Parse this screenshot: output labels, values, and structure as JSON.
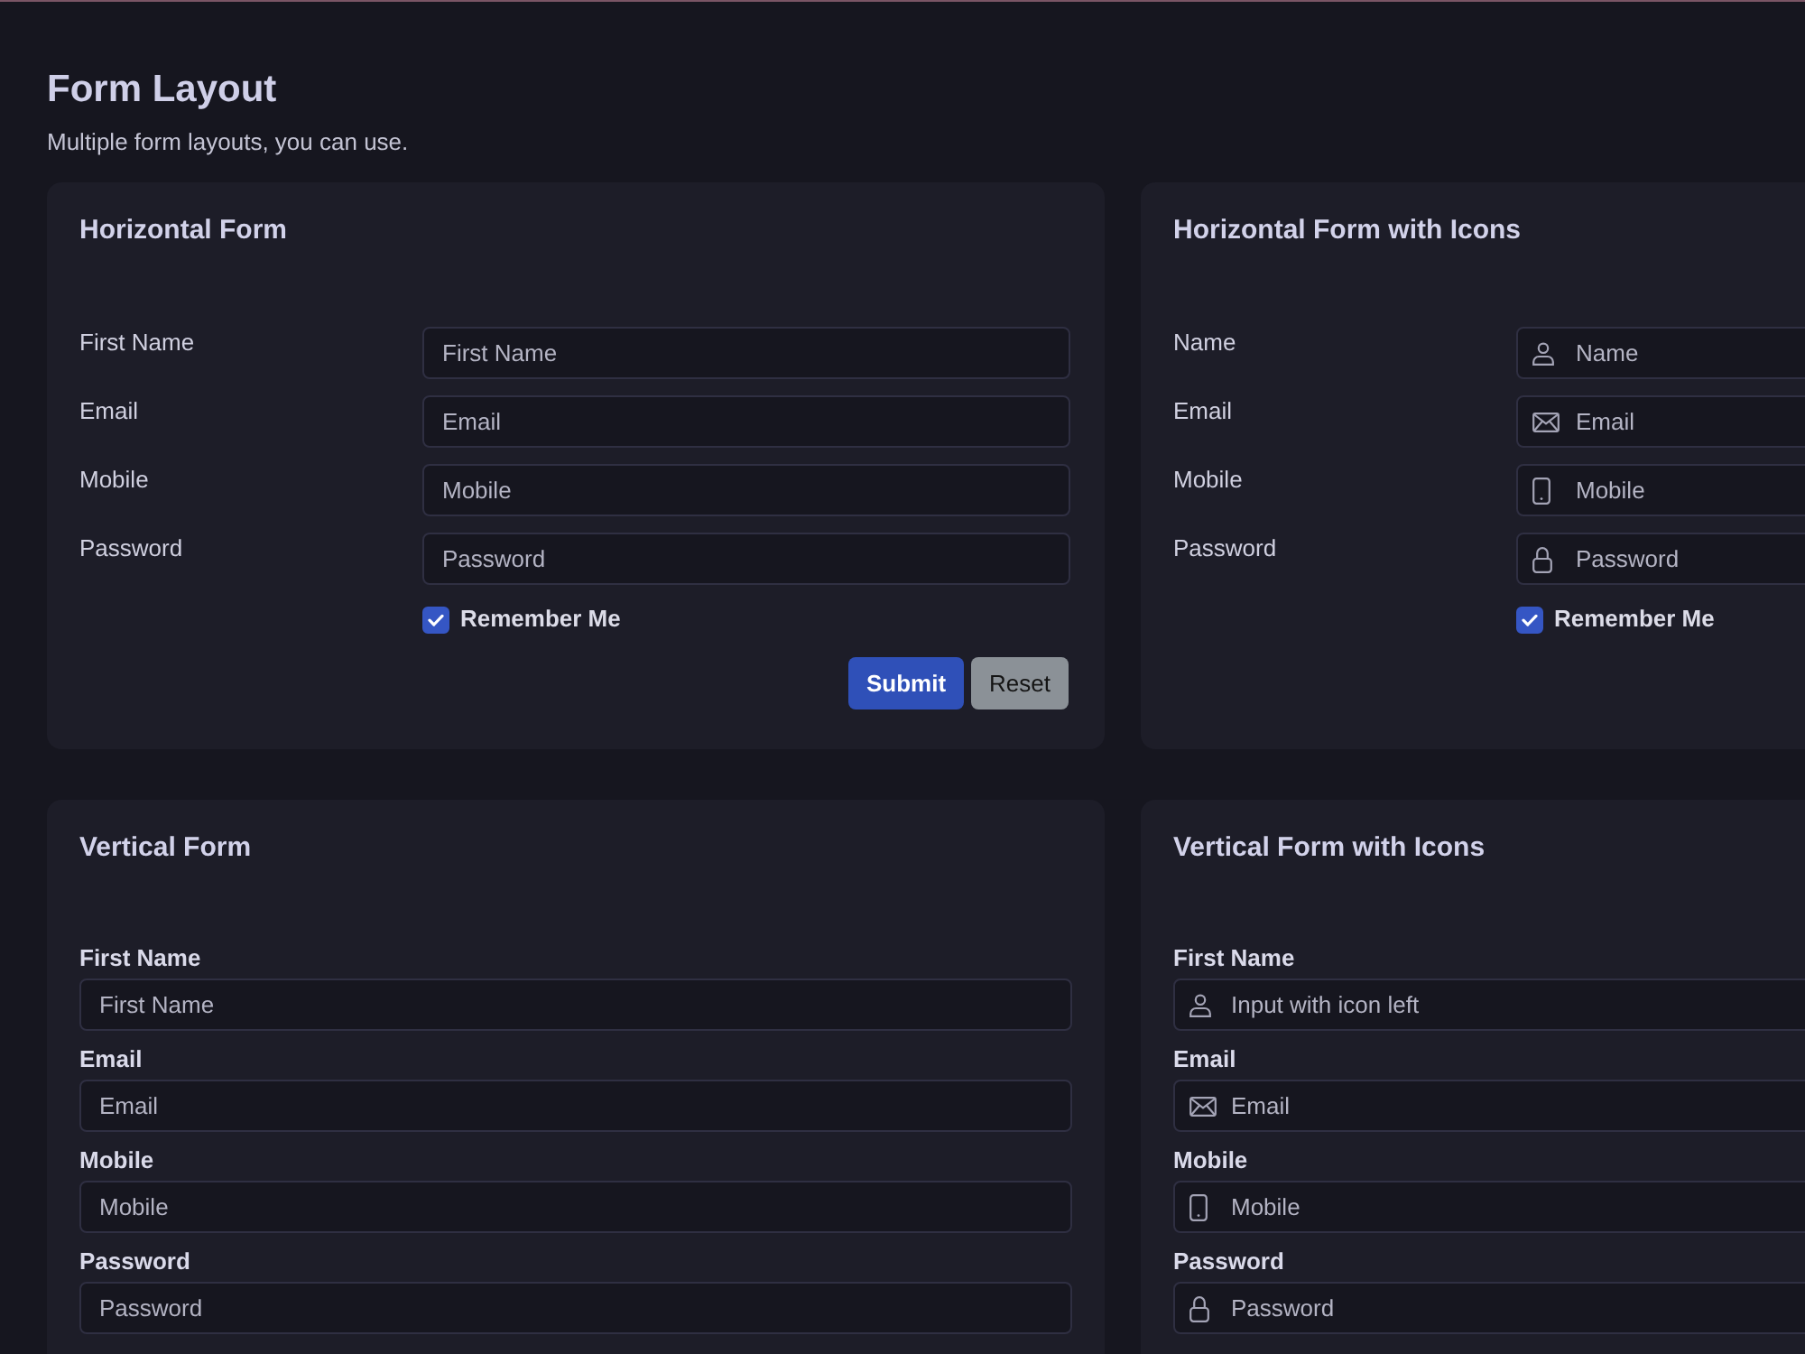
{
  "page": {
    "title": "Form Layout",
    "subtitle": "Multiple form layouts, you can use."
  },
  "cards": [
    {
      "title": "Horizontal Form",
      "kind": "horizontal",
      "fields": [
        {
          "label": "First Name",
          "placeholder": "First Name"
        },
        {
          "label": "Email",
          "placeholder": "Email"
        },
        {
          "label": "Mobile",
          "placeholder": "Mobile"
        },
        {
          "label": "Password",
          "placeholder": "Password"
        }
      ],
      "remember": {
        "label": "Remember Me",
        "checked": true
      },
      "buttons": [
        {
          "label": "Submit",
          "kind": "primary"
        },
        {
          "label": "Reset",
          "kind": "secondary"
        }
      ]
    },
    {
      "title": "Horizontal Form with Icons",
      "kind": "horizontal",
      "fields": [
        {
          "label": "Name",
          "placeholder": "Name",
          "kind": "name"
        },
        {
          "label": "Email",
          "placeholder": "Email",
          "kind": "email"
        },
        {
          "label": "Mobile",
          "placeholder": "Mobile",
          "kind": "mobile"
        },
        {
          "label": "Password",
          "placeholder": "Password",
          "kind": "password"
        }
      ],
      "remember": {
        "label": "Remember Me",
        "checked": true
      }
    },
    {
      "title": "Vertical Form",
      "kind": "vertical",
      "fields": [
        {
          "label": "First Name",
          "placeholder": "First Name"
        },
        {
          "label": "Email",
          "placeholder": "Email"
        },
        {
          "label": "Mobile",
          "placeholder": "Mobile"
        },
        {
          "label": "Password",
          "placeholder": "Password"
        }
      ]
    },
    {
      "title": "Vertical Form with Icons",
      "kind": "vertical",
      "fields": [
        {
          "label": "First Name",
          "placeholder": "Input with icon left",
          "kind": "name"
        },
        {
          "label": "Email",
          "placeholder": "Email",
          "kind": "email"
        },
        {
          "label": "Mobile",
          "placeholder": "Mobile",
          "kind": "mobile"
        },
        {
          "label": "Password",
          "placeholder": "Password",
          "kind": "password"
        }
      ]
    }
  ]
}
